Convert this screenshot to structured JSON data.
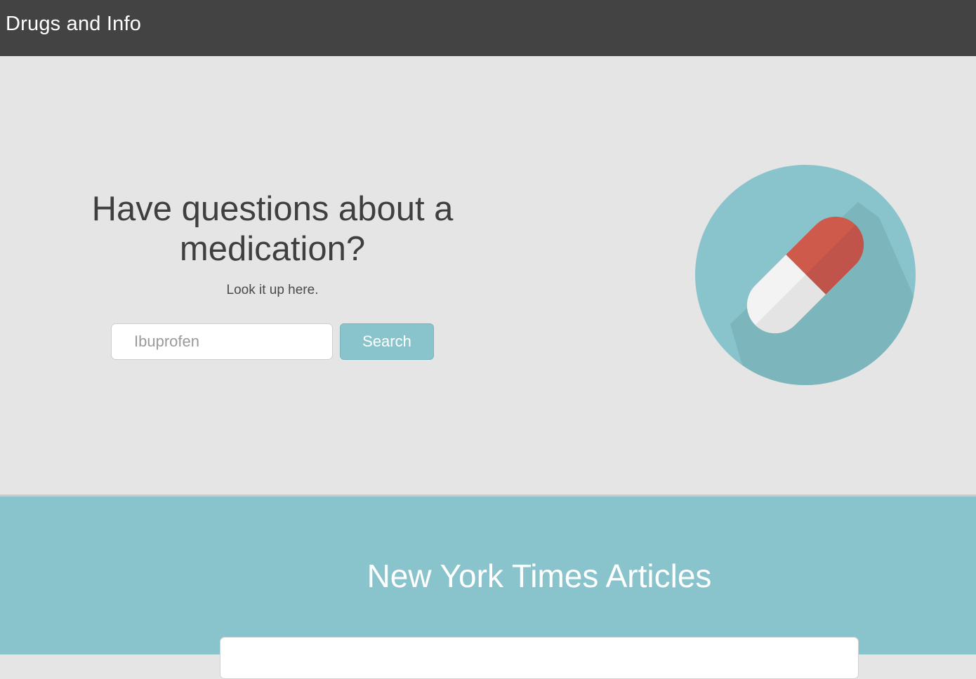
{
  "header": {
    "brand": "Drugs and Info"
  },
  "hero": {
    "headline": "Have questions about a medication?",
    "subline": "Look it up here.",
    "search": {
      "placeholder": "Ibuprofen",
      "value": "",
      "button_label": "Search"
    },
    "graphic_icon": "pill-capsule-icon"
  },
  "articles": {
    "title": "New York Times Articles"
  },
  "colors": {
    "navbar": "#434343",
    "hero_bg": "#e5e5e5",
    "accent": "#89c4cc",
    "pill_red": "#cd5a4b",
    "pill_white": "#f3f3f3"
  }
}
